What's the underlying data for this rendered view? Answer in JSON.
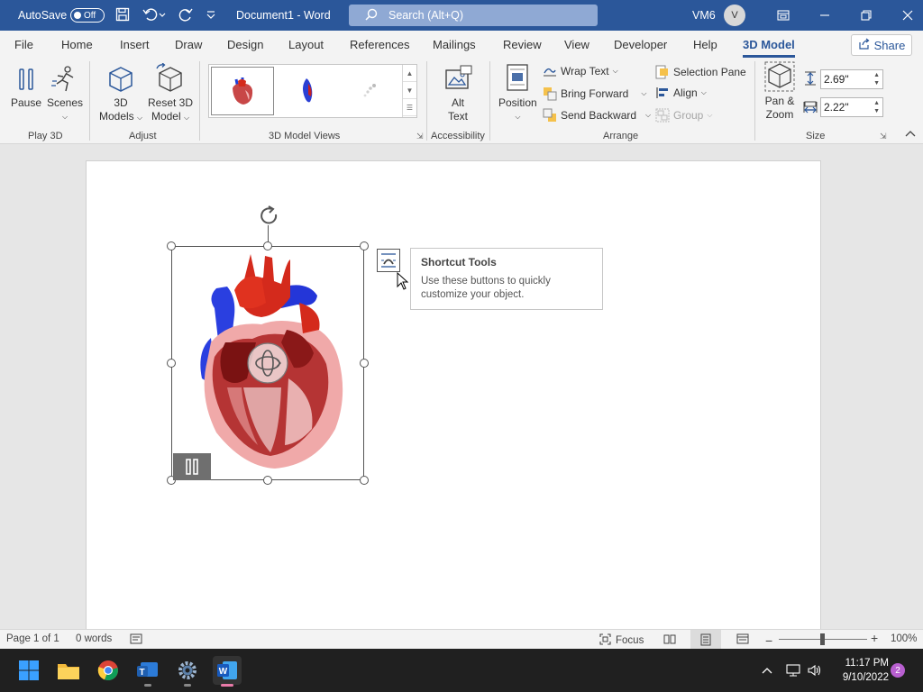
{
  "titlebar": {
    "autosave_label": "AutoSave",
    "autosave_state": "Off",
    "doc_title": "Document1  -  Word",
    "search_placeholder": "Search (Alt+Q)",
    "user_code": "VM6",
    "avatar_initial": "V"
  },
  "tabs": [
    {
      "label": "File"
    },
    {
      "label": "Home"
    },
    {
      "label": "Insert"
    },
    {
      "label": "Draw"
    },
    {
      "label": "Design"
    },
    {
      "label": "Layout"
    },
    {
      "label": "References"
    },
    {
      "label": "Mailings"
    },
    {
      "label": "Review"
    },
    {
      "label": "View"
    },
    {
      "label": "Developer"
    },
    {
      "label": "Help"
    },
    {
      "label": "3D Model"
    }
  ],
  "share_label": "Share",
  "ribbon": {
    "pause": "Pause",
    "scenes": "Scenes",
    "models_3d_l1": "3D",
    "models_3d_l2": "Models",
    "reset_l1": "Reset 3D",
    "reset_l2": "Model",
    "alt_text_l1": "Alt",
    "alt_text_l2": "Text",
    "position": "Position",
    "wrap_text": "Wrap Text",
    "bring_forward": "Bring Forward",
    "send_backward": "Send Backward",
    "selection_pane": "Selection Pane",
    "align": "Align",
    "group": "Group",
    "pan_zoom_l1": "Pan &",
    "pan_zoom_l2": "Zoom",
    "height_value": "2.69\"",
    "width_value": "2.22\"",
    "groups": {
      "play3d": "Play 3D",
      "adjust": "Adjust",
      "views": "3D Model Views",
      "accessibility": "Accessibility",
      "arrange": "Arrange",
      "size": "Size"
    }
  },
  "tooltip": {
    "title": "Shortcut Tools",
    "body_l1": "Use these buttons to quickly",
    "body_l2": "customize your object."
  },
  "statusbar": {
    "page": "Page 1 of 1",
    "words": "0 words",
    "focus": "Focus",
    "zoom": "100%"
  },
  "taskbar": {
    "time": "11:17 PM",
    "date": "9/10/2022",
    "notifications": "2"
  },
  "colors": {
    "word_blue": "#2b579a",
    "heart_red": "#d42a1c",
    "heart_blue": "#1f3fd6"
  }
}
